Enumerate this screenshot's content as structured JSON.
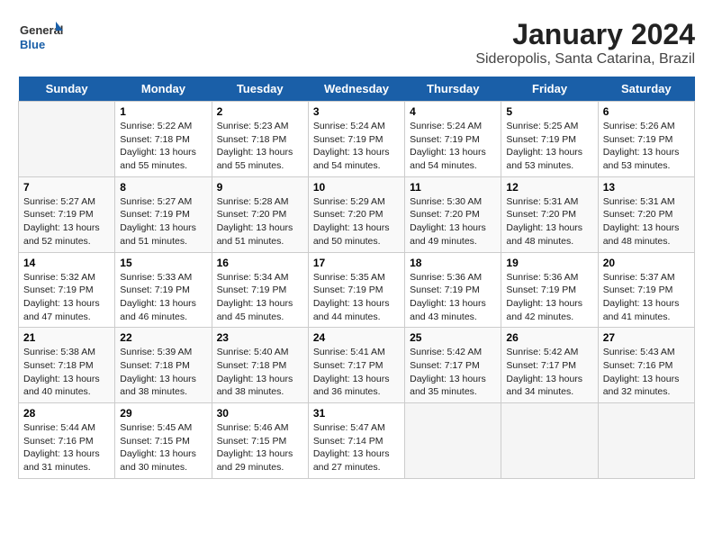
{
  "logo": {
    "line1": "General",
    "line2": "Blue"
  },
  "title": "January 2024",
  "subtitle": "Sideropolis, Santa Catarina, Brazil",
  "days": [
    "Sunday",
    "Monday",
    "Tuesday",
    "Wednesday",
    "Thursday",
    "Friday",
    "Saturday"
  ],
  "weeks": [
    [
      {
        "date": "",
        "sunrise": "",
        "sunset": "",
        "daylight": ""
      },
      {
        "date": "1",
        "sunrise": "Sunrise: 5:22 AM",
        "sunset": "Sunset: 7:18 PM",
        "daylight": "Daylight: 13 hours and 55 minutes."
      },
      {
        "date": "2",
        "sunrise": "Sunrise: 5:23 AM",
        "sunset": "Sunset: 7:18 PM",
        "daylight": "Daylight: 13 hours and 55 minutes."
      },
      {
        "date": "3",
        "sunrise": "Sunrise: 5:24 AM",
        "sunset": "Sunset: 7:19 PM",
        "daylight": "Daylight: 13 hours and 54 minutes."
      },
      {
        "date": "4",
        "sunrise": "Sunrise: 5:24 AM",
        "sunset": "Sunset: 7:19 PM",
        "daylight": "Daylight: 13 hours and 54 minutes."
      },
      {
        "date": "5",
        "sunrise": "Sunrise: 5:25 AM",
        "sunset": "Sunset: 7:19 PM",
        "daylight": "Daylight: 13 hours and 53 minutes."
      },
      {
        "date": "6",
        "sunrise": "Sunrise: 5:26 AM",
        "sunset": "Sunset: 7:19 PM",
        "daylight": "Daylight: 13 hours and 53 minutes."
      }
    ],
    [
      {
        "date": "7",
        "sunrise": "Sunrise: 5:27 AM",
        "sunset": "Sunset: 7:19 PM",
        "daylight": "Daylight: 13 hours and 52 minutes."
      },
      {
        "date": "8",
        "sunrise": "Sunrise: 5:27 AM",
        "sunset": "Sunset: 7:19 PM",
        "daylight": "Daylight: 13 hours and 51 minutes."
      },
      {
        "date": "9",
        "sunrise": "Sunrise: 5:28 AM",
        "sunset": "Sunset: 7:20 PM",
        "daylight": "Daylight: 13 hours and 51 minutes."
      },
      {
        "date": "10",
        "sunrise": "Sunrise: 5:29 AM",
        "sunset": "Sunset: 7:20 PM",
        "daylight": "Daylight: 13 hours and 50 minutes."
      },
      {
        "date": "11",
        "sunrise": "Sunrise: 5:30 AM",
        "sunset": "Sunset: 7:20 PM",
        "daylight": "Daylight: 13 hours and 49 minutes."
      },
      {
        "date": "12",
        "sunrise": "Sunrise: 5:31 AM",
        "sunset": "Sunset: 7:20 PM",
        "daylight": "Daylight: 13 hours and 48 minutes."
      },
      {
        "date": "13",
        "sunrise": "Sunrise: 5:31 AM",
        "sunset": "Sunset: 7:20 PM",
        "daylight": "Daylight: 13 hours and 48 minutes."
      }
    ],
    [
      {
        "date": "14",
        "sunrise": "Sunrise: 5:32 AM",
        "sunset": "Sunset: 7:19 PM",
        "daylight": "Daylight: 13 hours and 47 minutes."
      },
      {
        "date": "15",
        "sunrise": "Sunrise: 5:33 AM",
        "sunset": "Sunset: 7:19 PM",
        "daylight": "Daylight: 13 hours and 46 minutes."
      },
      {
        "date": "16",
        "sunrise": "Sunrise: 5:34 AM",
        "sunset": "Sunset: 7:19 PM",
        "daylight": "Daylight: 13 hours and 45 minutes."
      },
      {
        "date": "17",
        "sunrise": "Sunrise: 5:35 AM",
        "sunset": "Sunset: 7:19 PM",
        "daylight": "Daylight: 13 hours and 44 minutes."
      },
      {
        "date": "18",
        "sunrise": "Sunrise: 5:36 AM",
        "sunset": "Sunset: 7:19 PM",
        "daylight": "Daylight: 13 hours and 43 minutes."
      },
      {
        "date": "19",
        "sunrise": "Sunrise: 5:36 AM",
        "sunset": "Sunset: 7:19 PM",
        "daylight": "Daylight: 13 hours and 42 minutes."
      },
      {
        "date": "20",
        "sunrise": "Sunrise: 5:37 AM",
        "sunset": "Sunset: 7:19 PM",
        "daylight": "Daylight: 13 hours and 41 minutes."
      }
    ],
    [
      {
        "date": "21",
        "sunrise": "Sunrise: 5:38 AM",
        "sunset": "Sunset: 7:18 PM",
        "daylight": "Daylight: 13 hours and 40 minutes."
      },
      {
        "date": "22",
        "sunrise": "Sunrise: 5:39 AM",
        "sunset": "Sunset: 7:18 PM",
        "daylight": "Daylight: 13 hours and 38 minutes."
      },
      {
        "date": "23",
        "sunrise": "Sunrise: 5:40 AM",
        "sunset": "Sunset: 7:18 PM",
        "daylight": "Daylight: 13 hours and 38 minutes."
      },
      {
        "date": "24",
        "sunrise": "Sunrise: 5:41 AM",
        "sunset": "Sunset: 7:17 PM",
        "daylight": "Daylight: 13 hours and 36 minutes."
      },
      {
        "date": "25",
        "sunrise": "Sunrise: 5:42 AM",
        "sunset": "Sunset: 7:17 PM",
        "daylight": "Daylight: 13 hours and 35 minutes."
      },
      {
        "date": "26",
        "sunrise": "Sunrise: 5:42 AM",
        "sunset": "Sunset: 7:17 PM",
        "daylight": "Daylight: 13 hours and 34 minutes."
      },
      {
        "date": "27",
        "sunrise": "Sunrise: 5:43 AM",
        "sunset": "Sunset: 7:16 PM",
        "daylight": "Daylight: 13 hours and 32 minutes."
      }
    ],
    [
      {
        "date": "28",
        "sunrise": "Sunrise: 5:44 AM",
        "sunset": "Sunset: 7:16 PM",
        "daylight": "Daylight: 13 hours and 31 minutes."
      },
      {
        "date": "29",
        "sunrise": "Sunrise: 5:45 AM",
        "sunset": "Sunset: 7:15 PM",
        "daylight": "Daylight: 13 hours and 30 minutes."
      },
      {
        "date": "30",
        "sunrise": "Sunrise: 5:46 AM",
        "sunset": "Sunset: 7:15 PM",
        "daylight": "Daylight: 13 hours and 29 minutes."
      },
      {
        "date": "31",
        "sunrise": "Sunrise: 5:47 AM",
        "sunset": "Sunset: 7:14 PM",
        "daylight": "Daylight: 13 hours and 27 minutes."
      },
      {
        "date": "",
        "sunrise": "",
        "sunset": "",
        "daylight": ""
      },
      {
        "date": "",
        "sunrise": "",
        "sunset": "",
        "daylight": ""
      },
      {
        "date": "",
        "sunrise": "",
        "sunset": "",
        "daylight": ""
      }
    ]
  ]
}
